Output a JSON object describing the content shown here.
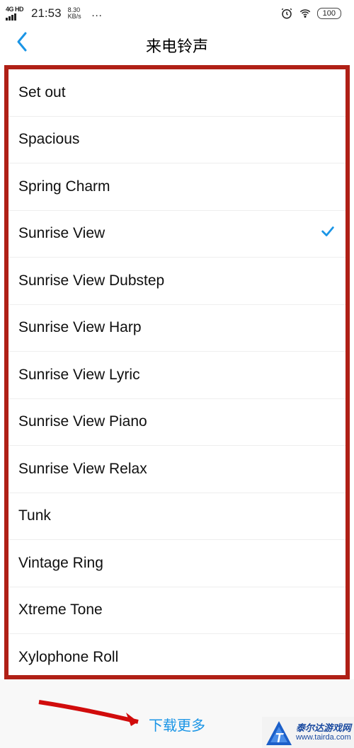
{
  "statusBar": {
    "network": "4G HD",
    "time": "21:53",
    "speed_value": "8.30",
    "speed_unit": "KB/s",
    "more": "…",
    "battery": "100"
  },
  "header": {
    "title": "来电铃声"
  },
  "ringtones": [
    {
      "name": "Set out",
      "selected": false
    },
    {
      "name": "Spacious",
      "selected": false
    },
    {
      "name": "Spring Charm",
      "selected": false
    },
    {
      "name": "Sunrise View",
      "selected": true
    },
    {
      "name": "Sunrise View Dubstep",
      "selected": false
    },
    {
      "name": "Sunrise View Harp",
      "selected": false
    },
    {
      "name": "Sunrise View Lyric",
      "selected": false
    },
    {
      "name": "Sunrise View Piano",
      "selected": false
    },
    {
      "name": "Sunrise View Relax",
      "selected": false
    },
    {
      "name": "Tunk",
      "selected": false
    },
    {
      "name": "Vintage Ring",
      "selected": false
    },
    {
      "name": "Xtreme Tone",
      "selected": false
    },
    {
      "name": "Xylophone Roll",
      "selected": false
    }
  ],
  "footer": {
    "download_more": "下载更多"
  },
  "watermark": {
    "line1": "泰尔达游戏网",
    "line2": "www.tairda.com"
  },
  "colors": {
    "accent": "#1a95e6",
    "highlight_border": "#b02016",
    "arrow": "#d10c0c",
    "wm_text": "#1a4aa0"
  }
}
